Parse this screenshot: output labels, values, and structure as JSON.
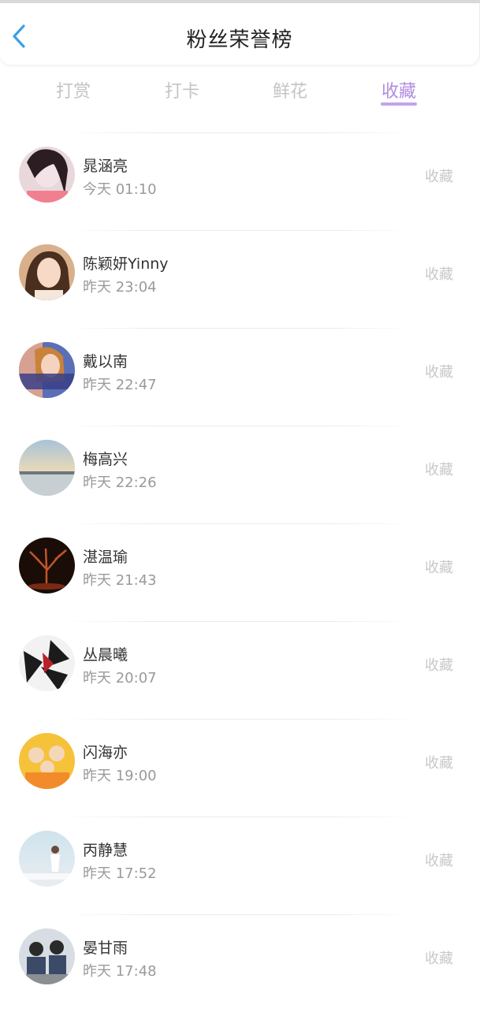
{
  "header": {
    "title": "粉丝荣誉榜",
    "back_icon": "chevron-left-icon"
  },
  "colors": {
    "accent": "#b18be0",
    "back": "#3aa0ea"
  },
  "tabs": [
    {
      "label": "打赏",
      "active": false
    },
    {
      "label": "打卡",
      "active": false
    },
    {
      "label": "鲜花",
      "active": false
    },
    {
      "label": "收藏",
      "active": true
    }
  ],
  "fans": [
    {
      "name": "晁涵亮",
      "time": "今天 01:10",
      "action": "收藏"
    },
    {
      "name": "陈颖妍Yinny",
      "time": "昨天 23:04",
      "action": "收藏"
    },
    {
      "name": "戴以南",
      "time": "昨天 22:47",
      "action": "收藏"
    },
    {
      "name": "梅高兴",
      "time": "昨天 22:26",
      "action": "收藏"
    },
    {
      "name": "湛温瑜",
      "time": "昨天 21:43",
      "action": "收藏"
    },
    {
      "name": "丛晨曦",
      "time": "昨天 20:07",
      "action": "收藏"
    },
    {
      "name": "闪海亦",
      "time": "昨天 19:00",
      "action": "收藏"
    },
    {
      "name": "丙静慧",
      "time": "昨天 17:52",
      "action": "收藏"
    },
    {
      "name": "晏甘雨",
      "time": "昨天 17:48",
      "action": "收藏"
    }
  ]
}
